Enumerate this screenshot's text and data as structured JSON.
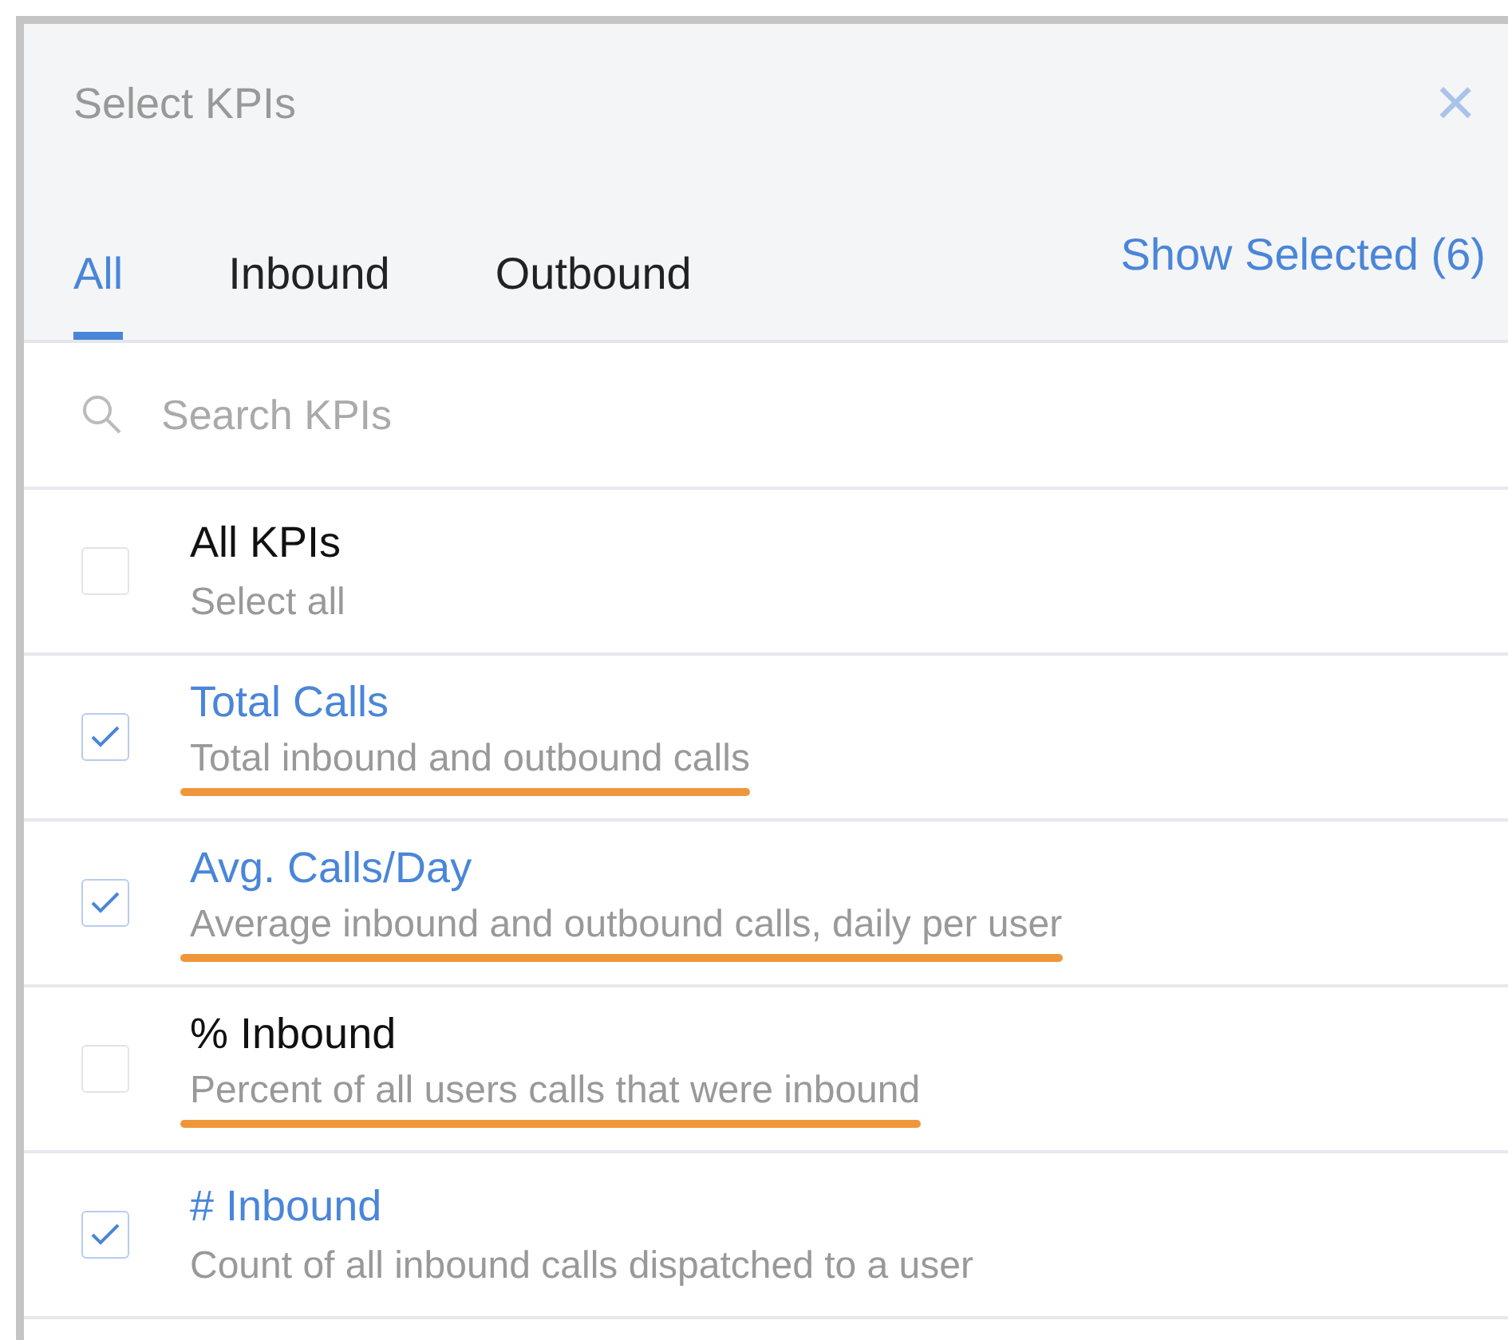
{
  "dialog": {
    "title": "Select KPIs",
    "close": "×"
  },
  "tabs": [
    {
      "label": "All",
      "selected": true
    },
    {
      "label": "Inbound",
      "selected": false
    },
    {
      "label": "Outbound",
      "selected": false
    }
  ],
  "show_selected": "Show Selected (6)",
  "search": {
    "placeholder": "Search KPIs"
  },
  "kpis": [
    {
      "name": "All KPIs",
      "description": "Select all",
      "checked": false,
      "underlined": false
    },
    {
      "name": "Total Calls",
      "description": "Total inbound and outbound calls",
      "checked": true,
      "underlined": true
    },
    {
      "name": "Avg. Calls/Day",
      "description": "Average inbound and outbound calls, daily per user",
      "checked": true,
      "underlined": true
    },
    {
      "name": "% Inbound",
      "description": "Percent of all users calls that were inbound",
      "checked": false,
      "underlined": true
    },
    {
      "name": "# Inbound",
      "description": "Count of all inbound calls dispatched to a user",
      "checked": true,
      "underlined": false
    }
  ]
}
